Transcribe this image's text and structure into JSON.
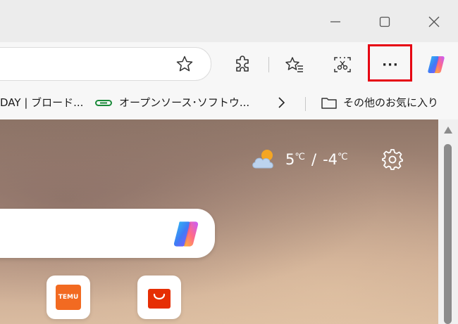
{
  "window": {
    "controls": [
      "minimize-icon",
      "maximize-icon",
      "close-icon"
    ]
  },
  "toolbar": {
    "url_value": "",
    "buttons": [
      "favorite-star-icon",
      "extensions-icon",
      "favorites-list-icon",
      "web-capture-icon",
      "more-menu-icon",
      "copilot-icon"
    ],
    "more_label": "···",
    "highlight_color": "#e60012"
  },
  "favorites_bar": {
    "item1": "DAY | ブロード...",
    "item2": "オープンソース･ソフトウ...",
    "other_folder": "その他のお気に入り"
  },
  "newtab": {
    "weather_temp": "5",
    "weather_unit": "℃",
    "weather_sep": "/",
    "weather_low": "-4",
    "weather_low_unit": "℃",
    "search_value": "",
    "tiles": [
      {
        "name": "temu-tile",
        "label": "TEMU",
        "color": "#f26a21"
      },
      {
        "name": "aliexpress-tile",
        "label": "",
        "color": "#e62e04"
      }
    ]
  }
}
